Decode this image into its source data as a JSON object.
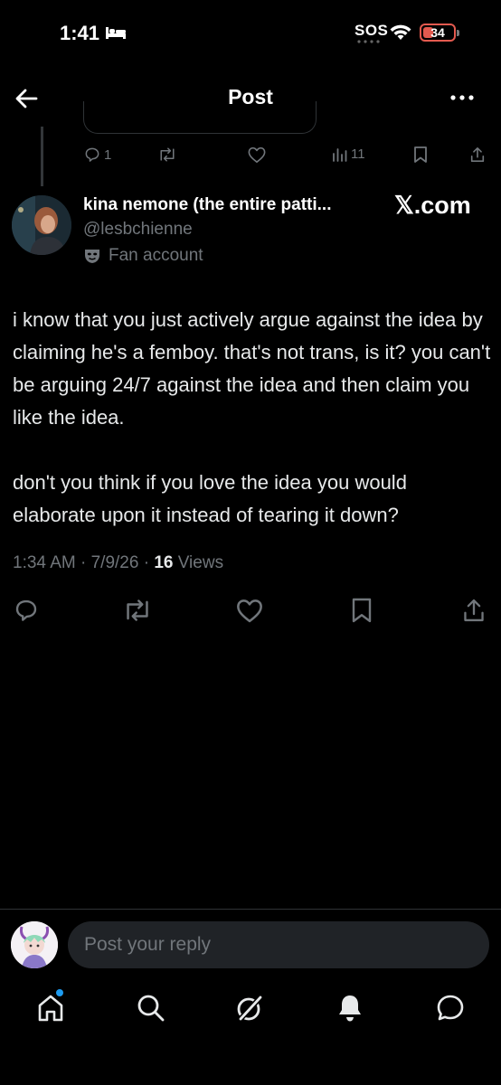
{
  "status_bar": {
    "time": "1:41",
    "sos": "SOS",
    "battery": "34",
    "icons": [
      "bed-icon",
      "wifi-icon",
      "battery-icon"
    ]
  },
  "header": {
    "title": "Post",
    "icons": [
      "back-arrow-icon",
      "more-icon"
    ]
  },
  "prev_tweet": {
    "reply_count": "1",
    "views": "11"
  },
  "author": {
    "name": "kina nemone (the entire patti...",
    "handle": "@lesbchienne",
    "label": "Fan account",
    "source": "𝕏.com"
  },
  "post": {
    "paragraphs": [
      "i know that you just actively argue against the idea by claiming he's a femboy. that's not trans, is it? you can't be arguing 24/7 against the idea and then claim you like the idea.",
      "don't you think if you love the idea you would elaborate upon it instead of tearing it down?"
    ],
    "time": "1:34 AM · 7/9/26 · ",
    "views_count": "16",
    "views_label": " Views"
  },
  "actions": [
    "reply-icon",
    "repost-icon",
    "like-icon",
    "bookmark-icon",
    "share-icon"
  ],
  "reply": {
    "placeholder": "Post your reply"
  },
  "nav": [
    "home-icon",
    "search-icon",
    "grok-icon",
    "notifications-icon",
    "messages-icon"
  ],
  "colors": {
    "background": "#000000",
    "text": "#e7e9ea",
    "secondary": "#71767b",
    "accent": "#1d9bf0",
    "battery": "#e35a4f"
  }
}
